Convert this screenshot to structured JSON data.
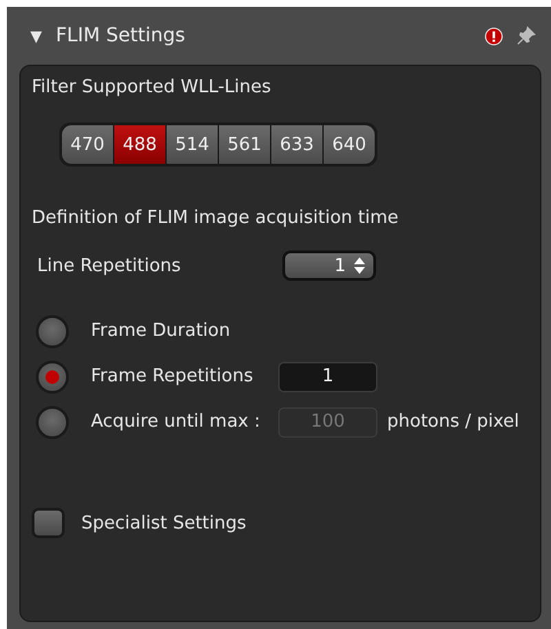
{
  "panel": {
    "collapse_glyph": "▼",
    "title": "FLIM Settings",
    "expanded": true
  },
  "filter": {
    "title": "Filter Supported WLL-Lines",
    "lines": [
      {
        "label": "470",
        "selected": false
      },
      {
        "label": "488",
        "selected": true
      },
      {
        "label": "514",
        "selected": false
      },
      {
        "label": "561",
        "selected": false
      },
      {
        "label": "633",
        "selected": false
      },
      {
        "label": "640",
        "selected": false
      }
    ]
  },
  "acquisition": {
    "title": "Definition of FLIM image acquisition time",
    "line_repetitions": {
      "label": "Line Repetitions",
      "value": "1"
    },
    "modes": [
      {
        "label": "Frame Duration",
        "selected": false
      },
      {
        "label": "Frame Repetitions",
        "selected": true,
        "value": "1",
        "disabled": false
      },
      {
        "label": "Acquire until max :",
        "selected": false,
        "value": "100",
        "disabled": true,
        "unit": "photons / pixel"
      }
    ]
  },
  "specialist": {
    "label": "Specialist Settings",
    "checked": false
  }
}
